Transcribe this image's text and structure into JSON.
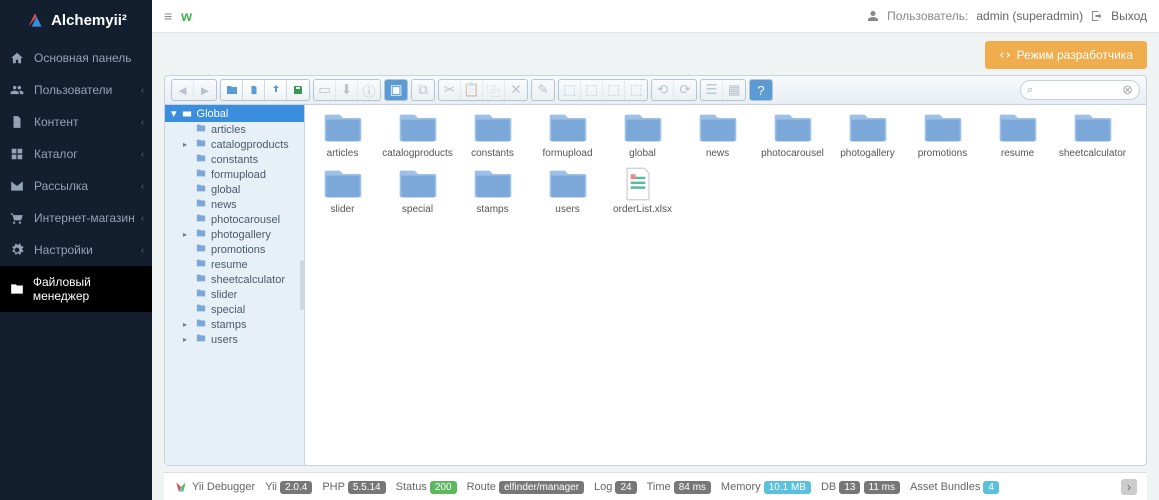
{
  "brand": "Alchemyii²",
  "user_label": "Пользователь:",
  "user_name": "admin (superadmin)",
  "logout": "Выход",
  "dev_mode": "Режим разработчика",
  "sidebar": {
    "items": [
      {
        "label": "Основная панель",
        "icon": "home",
        "name": "dashboard",
        "children": false
      },
      {
        "label": "Пользователи",
        "icon": "users",
        "name": "users",
        "children": true
      },
      {
        "label": "Контент",
        "icon": "file",
        "name": "content",
        "children": true
      },
      {
        "label": "Каталог",
        "icon": "grid",
        "name": "catalog",
        "children": true
      },
      {
        "label": "Рассылка",
        "icon": "mail",
        "name": "mailing",
        "children": true
      },
      {
        "label": "Интернет-магазин",
        "icon": "cart",
        "name": "shop",
        "children": true
      },
      {
        "label": "Настройки",
        "icon": "gear",
        "name": "settings",
        "children": true
      },
      {
        "label": "Файловый менеджер",
        "icon": "folder",
        "name": "filemanager",
        "children": false
      }
    ]
  },
  "fm": {
    "root": "Global",
    "tree": [
      {
        "label": "articles",
        "children": false
      },
      {
        "label": "catalogproducts",
        "children": true
      },
      {
        "label": "constants",
        "children": false
      },
      {
        "label": "formupload",
        "children": false
      },
      {
        "label": "global",
        "children": false
      },
      {
        "label": "news",
        "children": false
      },
      {
        "label": "photocarousel",
        "children": false
      },
      {
        "label": "photogallery",
        "children": true
      },
      {
        "label": "promotions",
        "children": false
      },
      {
        "label": "resume",
        "children": false
      },
      {
        "label": "sheetcalculator",
        "children": false
      },
      {
        "label": "slider",
        "children": false
      },
      {
        "label": "special",
        "children": false
      },
      {
        "label": "stamps",
        "children": true
      },
      {
        "label": "users",
        "children": true
      }
    ],
    "files": [
      {
        "label": "articles",
        "type": "folder"
      },
      {
        "label": "catalogproducts",
        "type": "folder"
      },
      {
        "label": "constants",
        "type": "folder"
      },
      {
        "label": "formupload",
        "type": "folder"
      },
      {
        "label": "global",
        "type": "folder"
      },
      {
        "label": "news",
        "type": "folder"
      },
      {
        "label": "photocarousel",
        "type": "folder"
      },
      {
        "label": "photogallery",
        "type": "folder"
      },
      {
        "label": "promotions",
        "type": "folder"
      },
      {
        "label": "resume",
        "type": "folder"
      },
      {
        "label": "sheetcalculator",
        "type": "folder"
      },
      {
        "label": "slider",
        "type": "folder"
      },
      {
        "label": "special",
        "type": "folder"
      },
      {
        "label": "stamps",
        "type": "folder"
      },
      {
        "label": "users",
        "type": "folder"
      },
      {
        "label": "orderList.xlsx",
        "type": "xlsx"
      }
    ],
    "search_placeholder": ""
  },
  "debug": {
    "title": "Yii Debugger",
    "yii_label": "Yii",
    "yii_ver": "2.0.4",
    "php_label": "PHP",
    "php_ver": "5.5.14",
    "status_label": "Status",
    "status": "200",
    "route_label": "Route",
    "route": "elfinder/manager",
    "log_label": "Log",
    "log": "24",
    "time_label": "Time",
    "time": "84 ms",
    "mem_label": "Memory",
    "mem": "10.1 MB",
    "db_label": "DB",
    "db_q": "13",
    "db_t": "11 ms",
    "bundles_label": "Asset Bundles",
    "bundles": "4"
  }
}
